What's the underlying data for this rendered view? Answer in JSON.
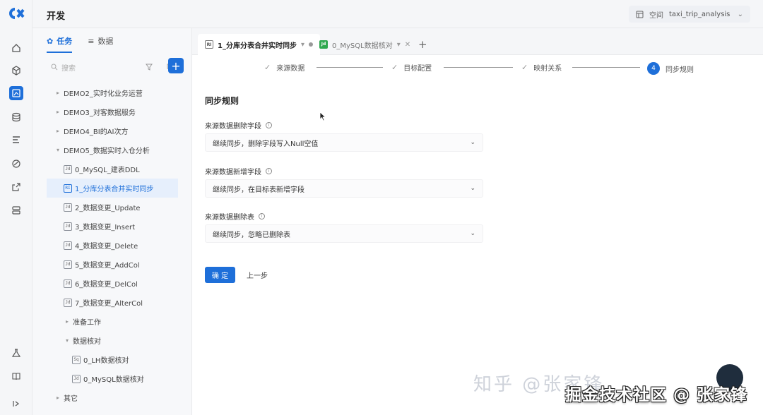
{
  "app": {
    "section_title": "开发",
    "space_label": "空间",
    "space_name": "taxi_trip_analysis"
  },
  "rail": {
    "icons": [
      "logo-icon",
      "home-icon",
      "cube-icon",
      "develop-icon",
      "database-icon",
      "list-icon",
      "palette-icon",
      "export-icon",
      "server-icon",
      "flask-icon",
      "book-icon",
      "expand-icon"
    ]
  },
  "panel": {
    "tabs": [
      {
        "label": "任务",
        "icon": "task-icon"
      },
      {
        "label": "数据",
        "icon": "database-icon"
      }
    ],
    "search_placeholder": "搜索",
    "tree": [
      {
        "kind": "folder",
        "label": "DEMO2_实时化业务运营",
        "caret": "▸"
      },
      {
        "kind": "folder",
        "label": "DEMO3_对客数据服务",
        "caret": "▸"
      },
      {
        "kind": "folder",
        "label": "DEMO4_BI的AI次方",
        "caret": "▸"
      },
      {
        "kind": "folder",
        "label": "DEMO5_数据实时入仓分析",
        "caret": "▾"
      },
      {
        "kind": "file",
        "label": "0_MySQL_建表DDL",
        "badge": "Jd"
      },
      {
        "kind": "file",
        "label": "1_分库分表合并实时同步",
        "badge": "RI",
        "selected": true
      },
      {
        "kind": "file",
        "label": "2_数据变更_Update",
        "badge": "Jd"
      },
      {
        "kind": "file",
        "label": "3_数据变更_Insert",
        "badge": "Jd"
      },
      {
        "kind": "file",
        "label": "4_数据变更_Delete",
        "badge": "Jd"
      },
      {
        "kind": "file",
        "label": "5_数据变更_AddCol",
        "badge": "Jd"
      },
      {
        "kind": "file",
        "label": "6_数据变更_DelCol",
        "badge": "Jd"
      },
      {
        "kind": "file",
        "label": "7_数据变更_AlterCol",
        "badge": "Jd"
      },
      {
        "kind": "subfolder",
        "label": "准备工作",
        "caret": "▸"
      },
      {
        "kind": "subfolder",
        "label": "数据核对",
        "caret": "▾"
      },
      {
        "kind": "subfile",
        "label": "0_LH数据核对",
        "badge": "Sq"
      },
      {
        "kind": "subfile",
        "label": "0_MySQL数据核对",
        "badge": "Jd"
      },
      {
        "kind": "folder",
        "label": "其它",
        "caret": "▸"
      }
    ]
  },
  "editor_tabs": [
    {
      "label": "1_分库分表合并实时同步",
      "badge": "RI",
      "active": true
    },
    {
      "label": "0_MySQL数据核对",
      "badge": "Jd",
      "active": false
    }
  ],
  "steps": [
    {
      "label": "来源数据",
      "done": true
    },
    {
      "label": "目标配置",
      "done": true
    },
    {
      "label": "映射关系",
      "done": true
    },
    {
      "label": "同步规则",
      "done": false,
      "number": "4"
    }
  ],
  "form": {
    "section_title": "同步规则",
    "fields": [
      {
        "label": "来源数据删除字段",
        "value": "继续同步，删除字段写入Null空值"
      },
      {
        "label": "来源数据新增字段",
        "value": "继续同步，在目标表新增字段"
      },
      {
        "label": "来源数据删除表",
        "value": "继续同步，忽略已删除表"
      }
    ],
    "confirm_label": "确 定",
    "prev_label": "上一步"
  },
  "watermark": {
    "gray_text": "知乎 @张家锋",
    "main_text": "掘金技术社区 @ 张家锋"
  },
  "colors": {
    "accent": "#1e6fd9",
    "rail_bg": "#f5f6f8"
  }
}
